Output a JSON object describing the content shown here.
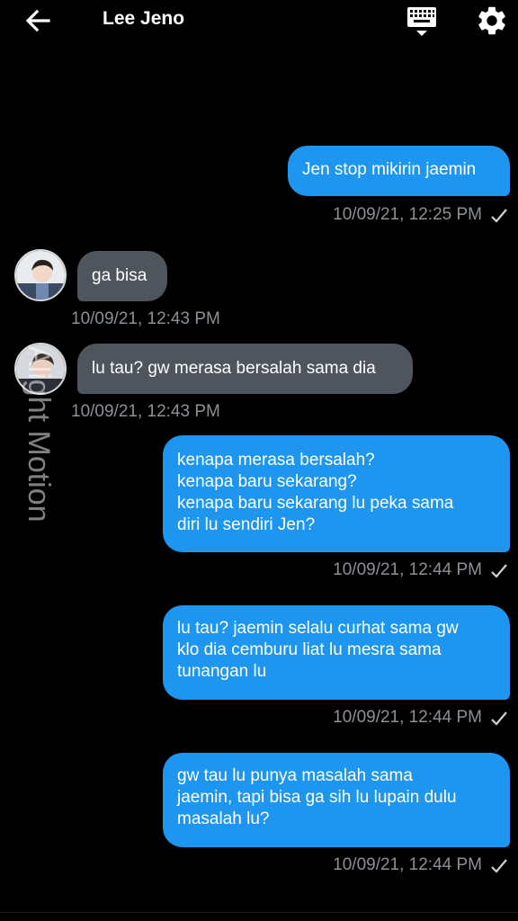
{
  "header": {
    "title": "Lee Jeno",
    "back_icon": "arrow-left-icon",
    "keyboard_icon": "keyboard-icon",
    "settings_icon": "gear-icon"
  },
  "colors": {
    "background": "#000000",
    "sent_bubble": "#1e96f0",
    "received_bubble": "#4e555d",
    "timestamp": "#8b9096"
  },
  "messages": [
    {
      "direction": "sent",
      "lines": [
        "Jen stop mikirin jaemin"
      ],
      "time": "10/09/21, 12:25 PM",
      "read_icon": "check-icon"
    },
    {
      "direction": "received",
      "lines": [
        "ga bisa"
      ],
      "time": "10/09/21, 12:43 PM"
    },
    {
      "direction": "received",
      "lines": [
        "lu tau? gw merasa bersalah sama dia"
      ],
      "time": "10/09/21, 12:43 PM"
    },
    {
      "direction": "sent",
      "lines": [
        "kenapa merasa bersalah?",
        "kenapa baru sekarang?",
        "kenapa baru sekarang lu peka sama",
        "diri lu sendiri Jen?"
      ],
      "time": "10/09/21, 12:44 PM",
      "read_icon": "check-icon"
    },
    {
      "direction": "sent",
      "lines": [
        "lu tau? jaemin selalu curhat sama gw",
        "klo dia cemburu liat lu mesra sama",
        "tunangan lu"
      ],
      "time": "10/09/21, 12:44 PM",
      "read_icon": "check-icon"
    },
    {
      "direction": "sent",
      "lines": [
        "gw tau lu punya masalah sama",
        "jaemin, tapi bisa ga sih lu lupain dulu",
        "masalah lu?"
      ],
      "time": "10/09/21, 12:44 PM",
      "read_icon": "check-icon"
    }
  ],
  "watermark": "Alight Motion"
}
